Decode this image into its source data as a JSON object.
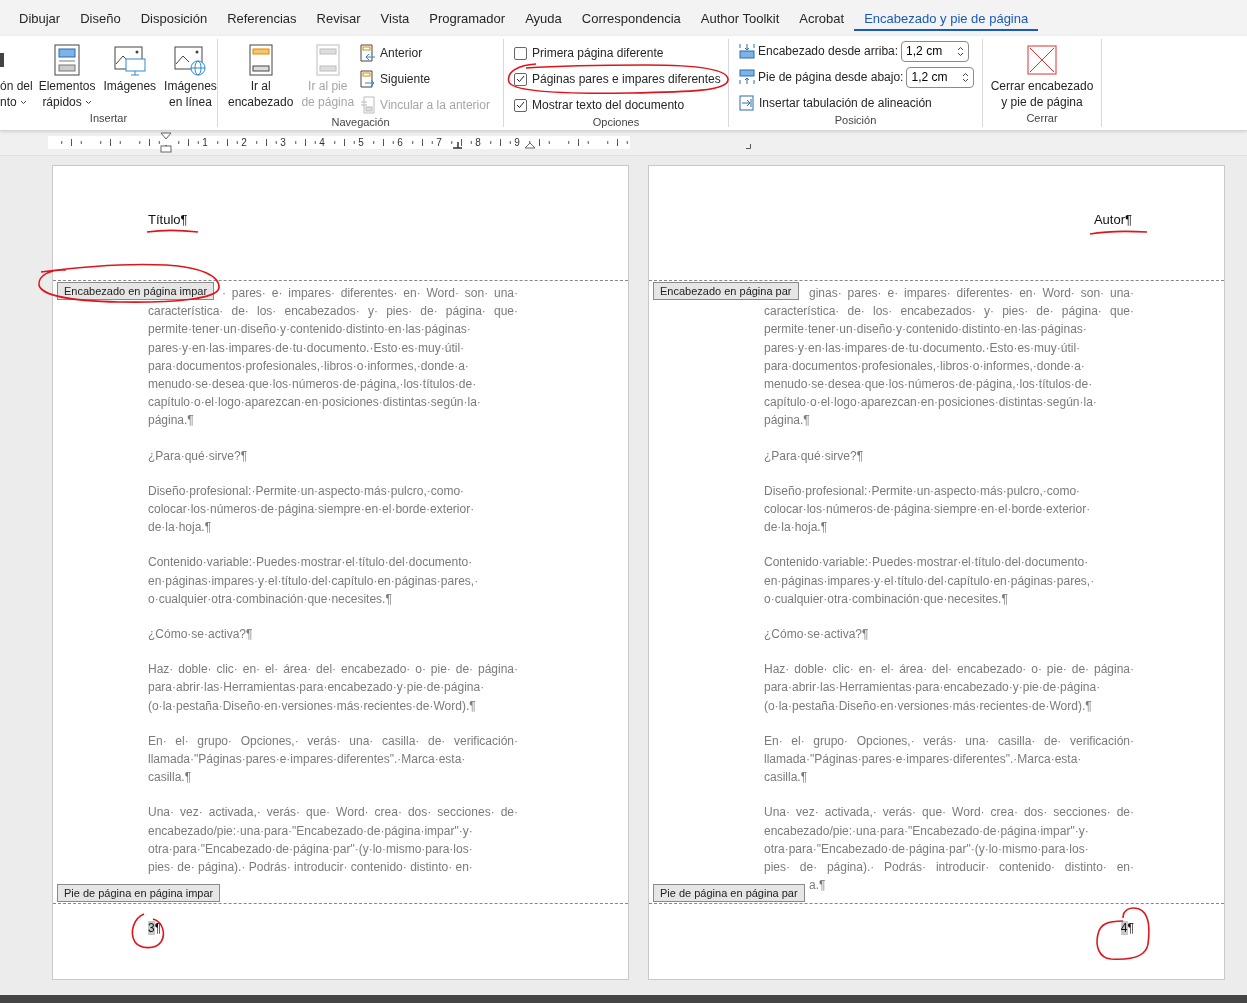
{
  "menu_tabs": [
    {
      "label": "Dibujar",
      "selected": false
    },
    {
      "label": "Diseño",
      "selected": false
    },
    {
      "label": "Disposición",
      "selected": false
    },
    {
      "label": "Referencias",
      "selected": false
    },
    {
      "label": "Revisar",
      "selected": false
    },
    {
      "label": "Vista",
      "selected": false
    },
    {
      "label": "Programador",
      "selected": false
    },
    {
      "label": "Ayuda",
      "selected": false
    },
    {
      "label": "Correspondencia",
      "selected": false
    },
    {
      "label": "Author Toolkit",
      "selected": false
    },
    {
      "label": "Acrobat",
      "selected": false
    },
    {
      "label": "Encabezado y pie de página",
      "selected": true
    }
  ],
  "ribbon": {
    "insert": {
      "label": "Insertar",
      "buttons": [
        {
          "kind": "cut",
          "lines": [
            "ón del",
            "nto"
          ],
          "dropdown": true
        },
        {
          "kind": "quick-parts",
          "lines": [
            "Elementos",
            "rápidos"
          ],
          "dropdown": true
        },
        {
          "kind": "pictures",
          "lines": [
            "Imágenes"
          ],
          "dropdown": false
        },
        {
          "kind": "online-pictures",
          "lines": [
            "Imágenes",
            "en línea"
          ],
          "dropdown": false
        }
      ]
    },
    "navigation": {
      "label": "Navegación",
      "large_buttons": [
        {
          "kind": "go-header",
          "lines": [
            "Ir al",
            "encabezado"
          ],
          "disabled": false
        },
        {
          "kind": "go-footer",
          "lines": [
            "Ir al pie",
            "de página"
          ],
          "disabled": true
        }
      ],
      "small_buttons": [
        {
          "kind": "previous",
          "label": "Anterior",
          "disabled": false
        },
        {
          "kind": "next",
          "label": "Siguiente",
          "disabled": false
        },
        {
          "kind": "link",
          "label": "Vincular a la anterior",
          "disabled": true
        }
      ]
    },
    "options": {
      "label": "Opciones",
      "checkboxes": [
        {
          "label": "Primera página diferente",
          "checked": false
        },
        {
          "label": "Páginas pares e impares diferentes",
          "checked": true
        },
        {
          "label": "Mostrar texto del documento",
          "checked": true
        }
      ]
    },
    "position": {
      "label": "Posición",
      "fields": [
        {
          "kind": "header",
          "label": "Encabezado desde arriba:",
          "value": "1,2 cm"
        },
        {
          "kind": "footer",
          "label": "Pie de página desde abajo:",
          "value": "1,2 cm"
        }
      ],
      "tab_button": "Insertar tabulación de alineación"
    },
    "close": {
      "label": "Cerrar",
      "lines": [
        "Cerrar encabezado",
        "y pie de página"
      ]
    }
  },
  "ruler": {
    "numbers": [
      "1",
      "2",
      "3",
      "4",
      "5",
      "6",
      "7",
      "8",
      "9"
    ]
  },
  "pages": [
    {
      "kind": "odd",
      "header_text": "Título¶",
      "header_tag": "Encabezado en página impar",
      "footer_tag": "Pie de página en página impar",
      "page_number": "3",
      "pilcrow": "¶",
      "paragraphs": [
        [
          "· pares· e· impares· diferentes· en· Word· son· una·",
          "característica· de· los· encabezados· y· pies· de· página· que·",
          "permite·tener·un·diseño·y·contenido·distinto·en·las·páginas·",
          "pares·y·en·las·impares·de·tu·documento.·Esto·es·muy·útil·",
          "para·documentos·profesionales,·libros·o·informes,·donde·a·",
          "menudo·se·desea·que·los·números·de·página,·los·títulos·de·",
          "capítulo·o·el·logo·aparezcan·en·posiciones·distintas·según·la·",
          "página.¶"
        ],
        [
          "¿Para·qué·sirve?¶"
        ],
        [
          "Diseño·profesional:·Permite·un·aspecto·más·pulcro,·como·",
          "colocar·los·números·de·página·siempre·en·el·borde·exterior·",
          "de·la·hoja.¶"
        ],
        [
          "Contenido·variable:·Puedes·mostrar·el·título·del·documento·",
          "en·páginas·impares·y·el·título·del·capítulo·en·páginas·pares,·",
          "o·cualquier·otra·combinación·que·necesites.¶"
        ],
        [
          "¿Cómo·se·activa?¶"
        ],
        [
          "Haz· doble· clic· en· el· área· del· encabezado· o· pie· de· página·",
          "para·abrir·las·Herramientas·para·encabezado·y·pie·de·página·",
          "(o·la·pestaña·Diseño·en·versiones·más·recientes·de·Word).¶"
        ],
        [
          "En· el· grupo· Opciones,· verás· una· casilla· de· verificación·",
          "llamada·\"Páginas·pares·e·impares·diferentes\".·Marca·esta·",
          "casilla.¶"
        ],
        [
          "Una· vez· activada,· verás· que· Word· crea· dos· secciones· de·",
          "encabezado/pie:·una·para·\"Encabezado·de·página·impar\"·y·",
          "otra·para·\"Encabezado·de·página·par\"·(y·lo·mismo·para·los·",
          "pies· de· página).· Podrás· introducir· contenido· distinto· en·"
        ]
      ]
    },
    {
      "kind": "even",
      "header_text": "Autor¶",
      "header_tag": "Encabezado en página par",
      "footer_tag": "Pie de página en página par",
      "page_number": "4",
      "pilcrow": "¶",
      "paragraphs": [
        [
          "ginas· pares· e· impares· diferentes· en· Word· son· una·",
          "característica· de· los· encabezados· y· pies· de· página· que·",
          "permite·tener·un·diseño·y·contenido·distinto·en·las·páginas·",
          "pares·y·en·las·impares·de·tu·documento.·Esto·es·muy·útil·",
          "para·documentos·profesionales,·libros·o·informes,·donde·a·",
          "menudo·se·desea·que·los·números·de·página,·los·títulos·de·",
          "capítulo·o·el·logo·aparezcan·en·posiciones·distintas·según·la·",
          "página.¶"
        ],
        [
          "¿Para·qué·sirve?¶"
        ],
        [
          "Diseño·profesional:·Permite·un·aspecto·más·pulcro,·como·",
          "colocar·los·números·de·página·siempre·en·el·borde·exterior·",
          "de·la·hoja.¶"
        ],
        [
          "Contenido·variable:·Puedes·mostrar·el·título·del·documento·",
          "en·páginas·impares·y·el·título·del·capítulo·en·páginas·pares,·",
          "o·cualquier·otra·combinación·que·necesites.¶"
        ],
        [
          "¿Cómo·se·activa?¶"
        ],
        [
          "Haz· doble· clic· en· el· área· del· encabezado· o· pie· de· página·",
          "para·abrir·las·Herramientas·para·encabezado·y·pie·de·página·",
          "(o·la·pestaña·Diseño·en·versiones·más·recientes·de·Word).¶"
        ],
        [
          "En· el· grupo· Opciones,· verás· una· casilla· de· verificación·",
          "llamada·\"Páginas·pares·e·impares·diferentes\".·Marca·esta·",
          "casilla.¶"
        ],
        [
          "Una· vez· activada,· verás· que· Word· crea· dos· secciones· de·",
          "encabezado/pie:·una·para·\"Encabezado·de·página·impar\"·y·",
          "otra·para·\"Encabezado·de·página·par\"·(y·lo·mismo·para·los·",
          "pies· de· página).· Podrás· introducir· contenido· distinto· en·",
          "a.¶"
        ]
      ]
    }
  ]
}
